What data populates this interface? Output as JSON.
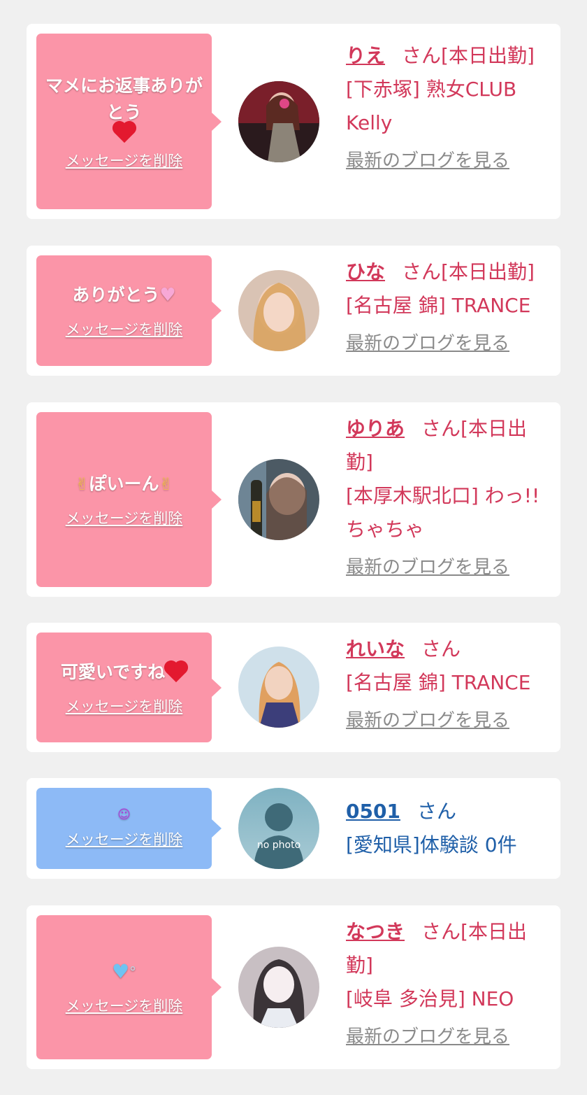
{
  "messages": [
    {
      "text": "マメにお返事ありがとう",
      "delete": "メッセージを削除",
      "name": "りえ",
      "san": "さん[本日出勤]",
      "shop": "[下赤塚] 熟女CLUB Kelly",
      "blog": "最新のブログを見る",
      "icon": "heart-icon"
    },
    {
      "text": "ありがとう",
      "delete": "メッセージを削除",
      "name": "ひな",
      "san": "さん[本日出勤]",
      "shop": "[名古屋 錦] TRANCE",
      "blog": "最新のブログを見る",
      "icon": "pink-heart-icon"
    },
    {
      "text": "ぽいーん",
      "delete": "メッセージを削除",
      "name": "ゆりあ",
      "san": "さん[本日出勤]",
      "shop": "[本厚木駅北口] わっ!! ちゃちゃ",
      "blog": "最新のブログを見る",
      "icon": "rock-hand-icon"
    },
    {
      "text": "可愛いですね",
      "delete": "メッセージを削除",
      "name": "れいな",
      "san": "さん",
      "shop": "[名古屋 錦] TRANCE",
      "blog": "最新のブログを見る",
      "icon": "heart-icon"
    },
    {
      "text": "",
      "delete": "メッセージを削除",
      "name": "0501",
      "san": "さん",
      "shop": "[愛知県]体験談 0件",
      "avatar_text": "no photo",
      "icon": "smiley-icon"
    },
    {
      "text": "",
      "delete": "メッセージを削除",
      "name": "なつき",
      "san": "さん[本日出勤]",
      "shop": "[岐阜 多治見] NEO",
      "blog": "最新のブログを見る",
      "icon": "blue-heart-icon"
    }
  ],
  "colors": {
    "pink_bubble": "#fb95a8",
    "blue_bubble": "#8dbaf6",
    "name_pink": "#d2385a",
    "name_blue": "#1f5fa8"
  }
}
